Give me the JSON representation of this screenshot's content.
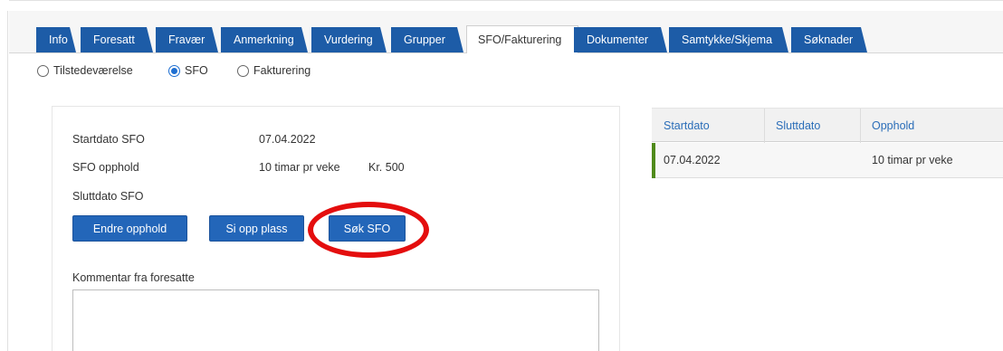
{
  "tabs": [
    {
      "label": "Info",
      "active": false
    },
    {
      "label": "Foresatt",
      "active": false
    },
    {
      "label": "Fravær",
      "active": false
    },
    {
      "label": "Anmerkning",
      "active": false
    },
    {
      "label": "Vurdering",
      "active": false
    },
    {
      "label": "Grupper",
      "active": false
    },
    {
      "label": "SFO/Fakturering",
      "active": true
    },
    {
      "label": "Dokumenter",
      "active": false
    },
    {
      "label": "Samtykke/Skjema",
      "active": false
    },
    {
      "label": "Søknader",
      "active": false
    }
  ],
  "view_options": [
    {
      "label": "Tilstedeværelse",
      "selected": false
    },
    {
      "label": "SFO",
      "selected": true
    },
    {
      "label": "Fakturering",
      "selected": false
    }
  ],
  "sfo_details": {
    "start_label": "Startdato SFO",
    "start_value": "07.04.2022",
    "stay_label": "SFO opphold",
    "stay_value": "10 timar pr veke",
    "stay_price": "Kr. 500",
    "end_label": "Sluttdato SFO",
    "end_value": ""
  },
  "actions": {
    "change_stay": "Endre opphold",
    "cancel_place": "Si opp plass",
    "apply_sfo": "Søk SFO"
  },
  "comment": {
    "label": "Kommentar fra foresatte",
    "value": ""
  },
  "history_table": {
    "columns": [
      "Startdato",
      "Sluttdato",
      "Opphold"
    ],
    "rows": [
      {
        "start": "07.04.2022",
        "end": "",
        "stay": "10 timar pr veke"
      }
    ]
  },
  "colors": {
    "tab_blue": "#1d5ca7",
    "button_blue": "#2366b9",
    "highlight_ring": "#e40e0e",
    "row_marker": "#4f8a1a",
    "header_text": "#2a6db8"
  }
}
